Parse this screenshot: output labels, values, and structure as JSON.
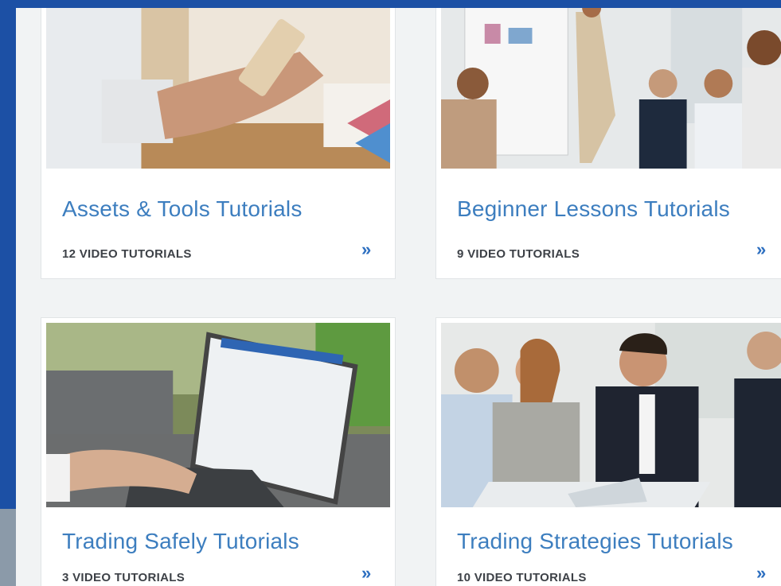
{
  "cards": [
    {
      "title": "Assets & Tools Tutorials",
      "count": "12 VIDEO TUTORIALS",
      "arrow": "»",
      "photo": "hand-holding-phone-over-documents"
    },
    {
      "title": "Beginner Lessons Tutorials",
      "count": "9 VIDEO TUTORIALS",
      "arrow": "»",
      "photo": "presenter-at-whiteboard-with-audience"
    },
    {
      "title": "Trading Safely Tutorials",
      "count": "3 VIDEO TUTORIALS",
      "arrow": "»",
      "photo": "hands-typing-on-laptop"
    },
    {
      "title": "Trading Strategies Tutorials",
      "count": "10 VIDEO TUTORIALS",
      "arrow": "»",
      "photo": "business-team-meeting"
    }
  ],
  "colors": {
    "frame": "#1c50a5",
    "panel": "#f1f3f4",
    "card": "#ffffff",
    "title": "#3d7ebf",
    "count": "#3d4147",
    "arrow": "#2d6fc0"
  }
}
